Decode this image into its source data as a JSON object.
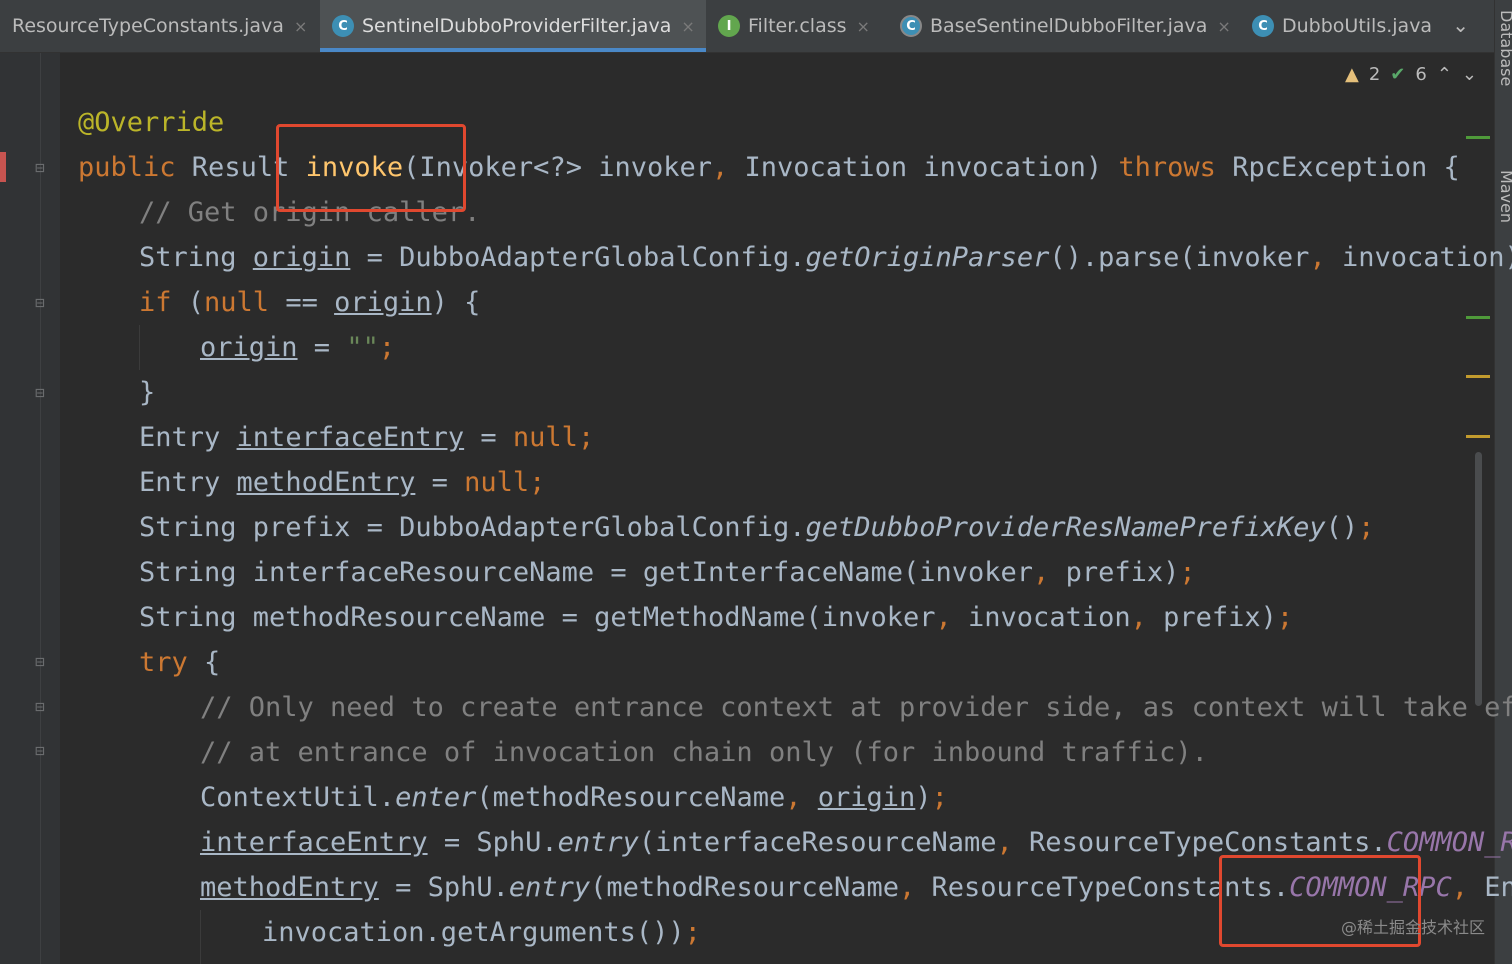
{
  "tabs": [
    {
      "label": "ResourceTypeConstants.java",
      "icon": "",
      "active": false
    },
    {
      "label": "SentinelDubboProviderFilter.java",
      "icon": "C",
      "active": true
    },
    {
      "label": "Filter.class",
      "icon": "I",
      "active": false
    },
    {
      "label": "BaseSentinelDubboFilter.java",
      "icon": "C",
      "active": false
    },
    {
      "label": "DubboUtils.java",
      "icon": "C",
      "active": false
    }
  ],
  "tab_close_glyph": "×",
  "tab_more_glyph": "⌄",
  "inspections": {
    "warnings": "2",
    "ok": "6"
  },
  "side_tools": {
    "database": "Database",
    "maven": "Maven"
  },
  "code": {
    "l1": {
      "a": "@Override"
    },
    "l2": {
      "kw": "public",
      "t1": " Result ",
      "fn": "invoke",
      "t2": "(Invoker<?> invoker",
      "c1": ",",
      "t3": " Invocation invocation) ",
      "kw2": "throws",
      "t4": " RpcException {"
    },
    "l3": {
      "cm": "// Get origin caller."
    },
    "l4": {
      "t1": "String ",
      "u": "origin",
      "t2": " = DubboAdapterGlobalConfig.",
      "it": "getOriginParser",
      "t3": "().parse(invoker",
      "c1": ",",
      "t4": " invocation)",
      "c2": ";"
    },
    "l5": {
      "kw": "if",
      "t1": " (",
      "kw2": "null",
      "t2": " == ",
      "u": "origin",
      "t3": ") {"
    },
    "l6": {
      "u": "origin",
      "t1": " = ",
      "s": "\"\"",
      "c1": ";"
    },
    "l7": {
      "t1": "}"
    },
    "l8": {
      "t1": "Entry ",
      "u": "interfaceEntry",
      "t2": " = ",
      "kw": "null",
      "c1": ";"
    },
    "l9": {
      "t1": "Entry ",
      "u": "methodEntry",
      "t2": " = ",
      "kw": "null",
      "c1": ";"
    },
    "l10": {
      "t1": "String prefix = DubboAdapterGlobalConfig.",
      "it": "getDubboProviderResNamePrefixKey",
      "t2": "()",
      "c1": ";"
    },
    "l11": {
      "t1": "String interfaceResourceName = getInterfaceName(invoker",
      "c1": ",",
      "t2": " prefix)",
      "c2": ";"
    },
    "l12": {
      "t1": "String methodResourceName = getMethodName(invoker",
      "c1": ",",
      "t2": " invocation",
      "c2": ",",
      "t3": " prefix)",
      "c3": ";"
    },
    "l13": {
      "kw": "try",
      "t1": " {"
    },
    "l14": {
      "cm": "// Only need to create entrance context at provider side, as context will take effec"
    },
    "l15": {
      "cm": "// at entrance of invocation chain only (for inbound traffic)."
    },
    "l16": {
      "t1": "ContextUtil.",
      "it": "enter",
      "t2": "(methodResourceName",
      "c1": ",",
      "sp": " ",
      "u": "origin",
      "t3": ")",
      "c2": ";"
    },
    "l17": {
      "u": "interfaceEntry",
      "t1": " = SphU.",
      "it": "entry",
      "t2": "(interfaceResourceName",
      "c1": ",",
      "t3": " ResourceTypeConstants.",
      "k": "COMMON_RPC",
      "c2": ","
    },
    "l18": {
      "u": "methodEntry",
      "t1": " = SphU.",
      "it": "entry",
      "t2": "(methodResourceName",
      "c1": ",",
      "t3": " ResourceTypeConstants.",
      "k": "COMMON_RPC",
      "c2": ",",
      "t4": " Entry"
    },
    "l19": {
      "t1": "invocation.getArguments())",
      "c1": ";"
    }
  },
  "watermark": "@稀土掘金技术社区",
  "colors": {
    "keyword": "#cc7832",
    "annotation": "#bbb529",
    "comment": "#808080",
    "constant": "#9876aa",
    "highlight_box": "#e0482f"
  }
}
